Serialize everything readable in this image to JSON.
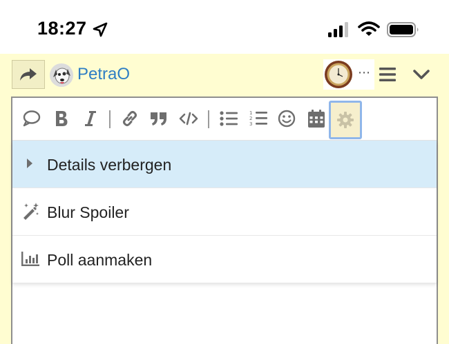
{
  "status_bar": {
    "time": "18:27"
  },
  "header": {
    "username": "PetraO",
    "more_indicator": "⋯"
  },
  "toolbar": {
    "buttons": [
      "quote",
      "bold",
      "italic",
      "link",
      "blockquote",
      "code",
      "bullet-list",
      "numbered-list",
      "emoji",
      "date",
      "settings"
    ]
  },
  "dropdown": {
    "items": [
      {
        "label": "Details verbergen",
        "icon": "caret-right-icon",
        "selected": true
      },
      {
        "label": "Blur Spoiler",
        "icon": "magic-wand-icon",
        "selected": false
      },
      {
        "label": "Poll aanmaken",
        "icon": "bar-chart-icon",
        "selected": false
      }
    ]
  },
  "colors": {
    "page_bg": "#fffdd1",
    "username": "#2e7ec4",
    "selected_row": "#d6ecf9",
    "gear_focus": "#8fb6ea",
    "icon_gray": "#6e6e6e"
  }
}
